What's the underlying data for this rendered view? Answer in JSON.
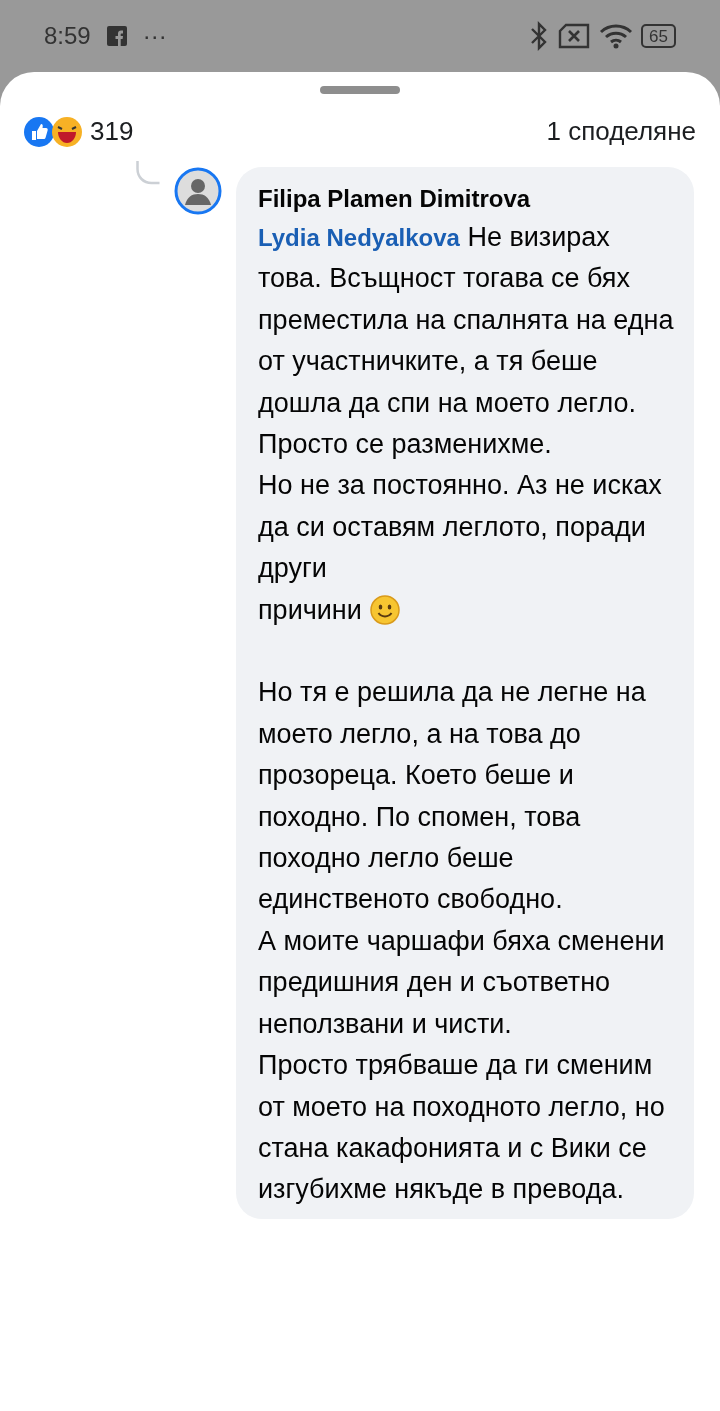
{
  "status_bar": {
    "time": "8:59",
    "more": "···",
    "battery": "65"
  },
  "reactions": {
    "count": "319",
    "shares": "1 споделяне"
  },
  "comment": {
    "author": "Filipa Plamen Dimitrova",
    "mention": "Lydia Nedyalkova",
    "paragraphs": [
      {
        "kind": "plain",
        "text": "Не визирах това. Всъщност тогава се бях преместила на спалнята на една от участничките, а тя беше дошла да спи на моето легло. Просто се разменихме.",
        "blank_line_before": false
      },
      {
        "kind": "smiley_end",
        "text": "Но не за постоянно. Аз не исках да си оставям леглото, поради други",
        "last_line": "причини",
        "blank_line_before": false
      },
      {
        "kind": "plain",
        "text": "Но тя е решила да не легне на моето легло, а на това до прозореца. Което беше и походно. По спомен, това походно легло беше единственото свободно.",
        "blank_line_before": true
      },
      {
        "kind": "plain",
        "text": "А моите чаршафи бяха сменени предишния ден и съответно неползвани и чисти.",
        "blank_line_before": false
      },
      {
        "kind": "plain",
        "text": "Просто трябваше да ги сменим от моето на походното легло, но стана какафонията и с Вики се изгубихме някъде в превода.",
        "blank_line_before": false
      }
    ]
  }
}
